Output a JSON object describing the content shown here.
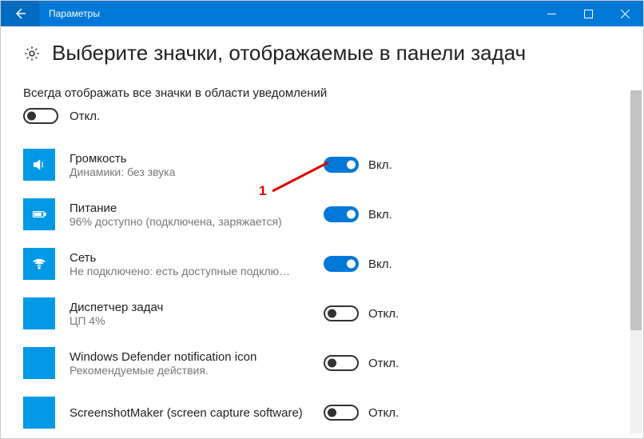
{
  "window": {
    "title": "Параметры"
  },
  "page": {
    "heading": "Выберите значки, отображаемые в панели задач",
    "all_label": "Всегда отображать все значки в области уведомлений",
    "master_state": "Откл."
  },
  "state_on": "Вкл.",
  "state_off": "Откл.",
  "items": [
    {
      "title": "Громкость",
      "subtitle": "Динамики: без звука",
      "on": true,
      "icon": "volume"
    },
    {
      "title": "Питание",
      "subtitle": "96% доступно (подключена, заряжается)",
      "on": true,
      "icon": "battery"
    },
    {
      "title": "Сеть",
      "subtitle": "Не подключено: есть доступные подклю…",
      "on": true,
      "icon": "wifi"
    },
    {
      "title": "Диспетчер задач",
      "subtitle": "ЦП 4%",
      "on": false,
      "icon": "blank"
    },
    {
      "title": "Windows Defender notification icon",
      "subtitle": "Рекомендуемые действия.",
      "on": false,
      "icon": "blank"
    },
    {
      "title": "ScreenshotMaker (screen capture software)",
      "subtitle": "",
      "on": false,
      "icon": "blank"
    }
  ],
  "annotation": {
    "label": "1"
  }
}
